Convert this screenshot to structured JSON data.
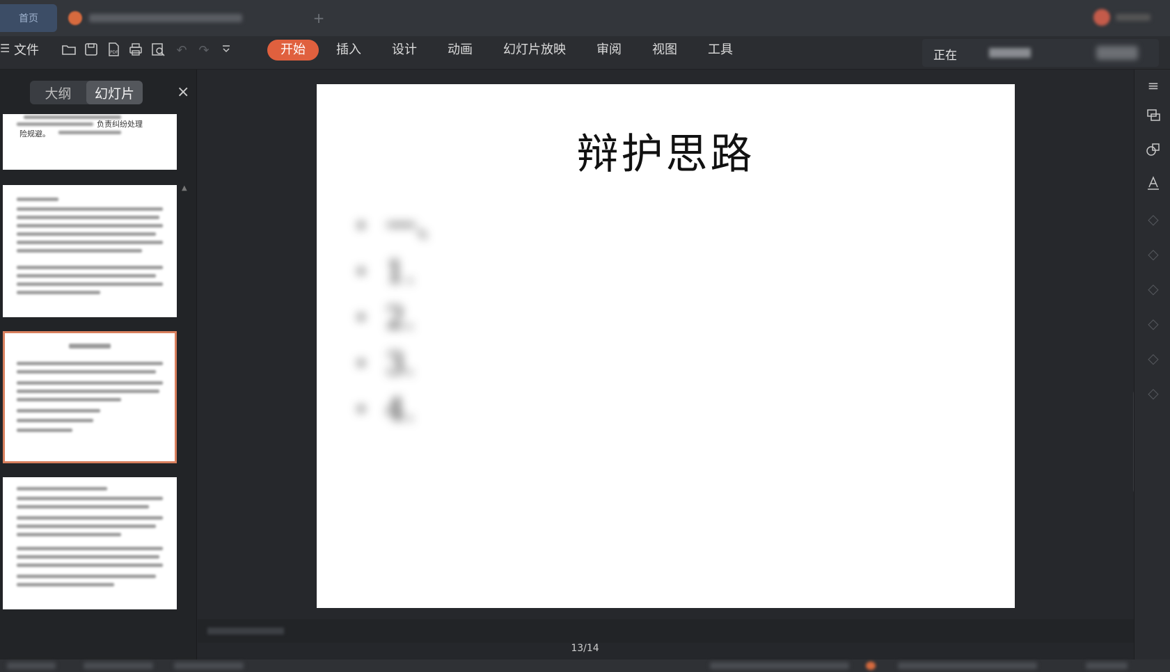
{
  "titlebar": {
    "home_label": "首页",
    "add_tab": "+"
  },
  "menubar": {
    "menu_glyph": "☰",
    "file_label": "文件",
    "tabs": [
      {
        "label": "开始",
        "active": true
      },
      {
        "label": "插入",
        "active": false
      },
      {
        "label": "设计",
        "active": false
      },
      {
        "label": "动画",
        "active": false
      },
      {
        "label": "幻灯片放映",
        "active": false
      },
      {
        "label": "审阅",
        "active": false
      },
      {
        "label": "视图",
        "active": false
      },
      {
        "label": "工具",
        "active": false
      }
    ],
    "status_text": "正在"
  },
  "left_panel": {
    "outline_label": "大纲",
    "slides_label": "幻灯片",
    "close_glyph": "×",
    "thumb1_text_a": "负责纠纷处理",
    "thumb1_text_b": "险规避。"
  },
  "slide": {
    "title": "辩护思路",
    "bullets": [
      "一、",
      "1.",
      "2.",
      "3.",
      "4."
    ]
  },
  "footer": {
    "page_indicator": "13/14"
  },
  "colors": {
    "accent": "#e0603e",
    "background": "#25272b",
    "selected_thumb_border": "#d9805e"
  }
}
